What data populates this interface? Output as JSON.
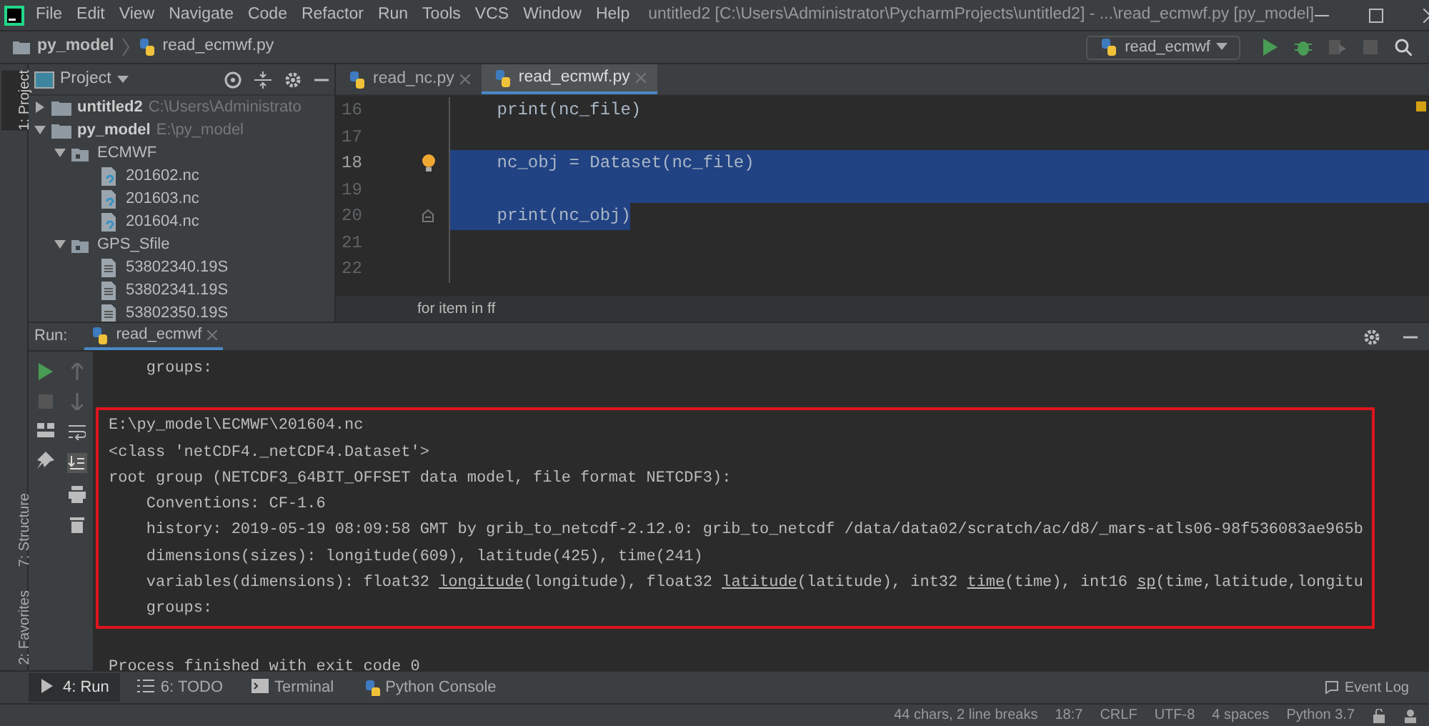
{
  "menu_bar": {
    "items": [
      "File",
      "Edit",
      "View",
      "Navigate",
      "Code",
      "Refactor",
      "Run",
      "Tools",
      "VCS",
      "Window",
      "Help"
    ],
    "title": "untitled2 [C:\\Users\\Administrator\\PycharmProjects\\untitled2] - ...\\read_ecmwf.py [py_model]"
  },
  "nav_bar": {
    "crumbs": [
      "py_model",
      "read_ecmwf.py"
    ],
    "run_config": "read_ecmwf"
  },
  "side_stripe": {
    "top": [
      {
        "label": "1: Project",
        "selected": true
      }
    ],
    "bottom": [
      {
        "label": "7: Structure",
        "selected": false
      },
      {
        "label": "2: Favorites",
        "selected": false
      }
    ]
  },
  "project": {
    "title": "Project",
    "tree": [
      {
        "label": "untitled2",
        "hint": "C:\\Users\\Administrato",
        "kind": "module",
        "expanded": false
      },
      {
        "label": "py_model",
        "hint": "E:\\py_model",
        "kind": "module",
        "expanded": true,
        "children": [
          {
            "label": "ECMWF",
            "kind": "folder",
            "expanded": true,
            "children": [
              {
                "label": "201602.nc",
                "kind": "unknown"
              },
              {
                "label": "201603.nc",
                "kind": "unknown"
              },
              {
                "label": "201604.nc",
                "kind": "unknown"
              }
            ]
          },
          {
            "label": "GPS_Sfile",
            "kind": "folder",
            "expanded": true,
            "children": [
              {
                "label": "53802340.19S",
                "kind": "text"
              },
              {
                "label": "53802341.19S",
                "kind": "text"
              },
              {
                "label": "53802350.19S",
                "kind": "text"
              }
            ]
          }
        ]
      }
    ]
  },
  "editor": {
    "tabs": [
      {
        "label": "read_nc.py",
        "selected": false
      },
      {
        "label": "read_ecmwf.py",
        "selected": true
      }
    ],
    "lines": [
      {
        "number": "16",
        "code": "    print(nc_file)",
        "selected": false,
        "current": false
      },
      {
        "number": "17",
        "selected": false,
        "current": false
      },
      {
        "number": "18",
        "code": "    nc_obj = Dataset(nc_file)",
        "selected": true,
        "current": true
      },
      {
        "number": "19",
        "selected": true,
        "current": false
      },
      {
        "number": "20",
        "code": "    print(nc_obj)",
        "selected": true,
        "current": false
      },
      {
        "number": "21",
        "selected": false,
        "current": false
      },
      {
        "number": "22",
        "selected": false,
        "current": false
      }
    ],
    "breadcrumb": "for item in ff"
  },
  "run_panel": {
    "label": "Run:",
    "tab": "read_ecmwf",
    "before": [
      {
        "segments": [
          {
            "text": "    groups:"
          }
        ]
      }
    ],
    "framed": [
      {
        "segments": [
          {
            "text": "E:\\py_model\\ECMWF\\201604.nc"
          }
        ]
      },
      {
        "segments": [
          {
            "text": "<class 'netCDF4._netCDF4.Dataset'>"
          }
        ]
      },
      {
        "segments": [
          {
            "text": "root group (NETCDF3_64BIT_OFFSET data model, file format NETCDF3):"
          }
        ]
      },
      {
        "segments": [
          {
            "text": "    Conventions: CF-1.6"
          }
        ]
      },
      {
        "segments": [
          {
            "text": "    history: 2019-05-19 08:09:58 GMT by grib_to_netcdf-2.12.0: grib_to_netcdf /data/data02/scratch/ac/d8/_mars-atls06-98f536083ae965b"
          }
        ]
      },
      {
        "segments": [
          {
            "text": "    dimensions(sizes): longitude(609), latitude(425), time(241)"
          }
        ]
      },
      {
        "segments": [
          {
            "text": "    variables(dimensions): float32 "
          },
          {
            "text": "longitude",
            "underline": true
          },
          {
            "text": "(longitude), float32 "
          },
          {
            "text": "latitude",
            "underline": true
          },
          {
            "text": "(latitude), int32 "
          },
          {
            "text": "time",
            "underline": true
          },
          {
            "text": "(time), int16 "
          },
          {
            "text": "sp",
            "underline": true
          },
          {
            "text": "(time,latitude,longitu"
          }
        ]
      },
      {
        "segments": [
          {
            "text": "    groups:"
          }
        ]
      }
    ],
    "after": [
      {
        "segments": [
          {
            "text": "Process finished with exit code 0"
          }
        ]
      }
    ]
  },
  "tool_tabs": [
    {
      "label": "4: Run",
      "selected": true
    },
    {
      "label": "6: TODO",
      "selected": false
    },
    {
      "label": "Terminal",
      "selected": false
    },
    {
      "label": "Python Console",
      "selected": false
    }
  ],
  "event_log": "Event Log",
  "status_bar": [
    "44 chars, 2 line breaks",
    "18:7",
    "CRLF",
    "UTF-8",
    "4 spaces",
    "Python 3.7"
  ]
}
